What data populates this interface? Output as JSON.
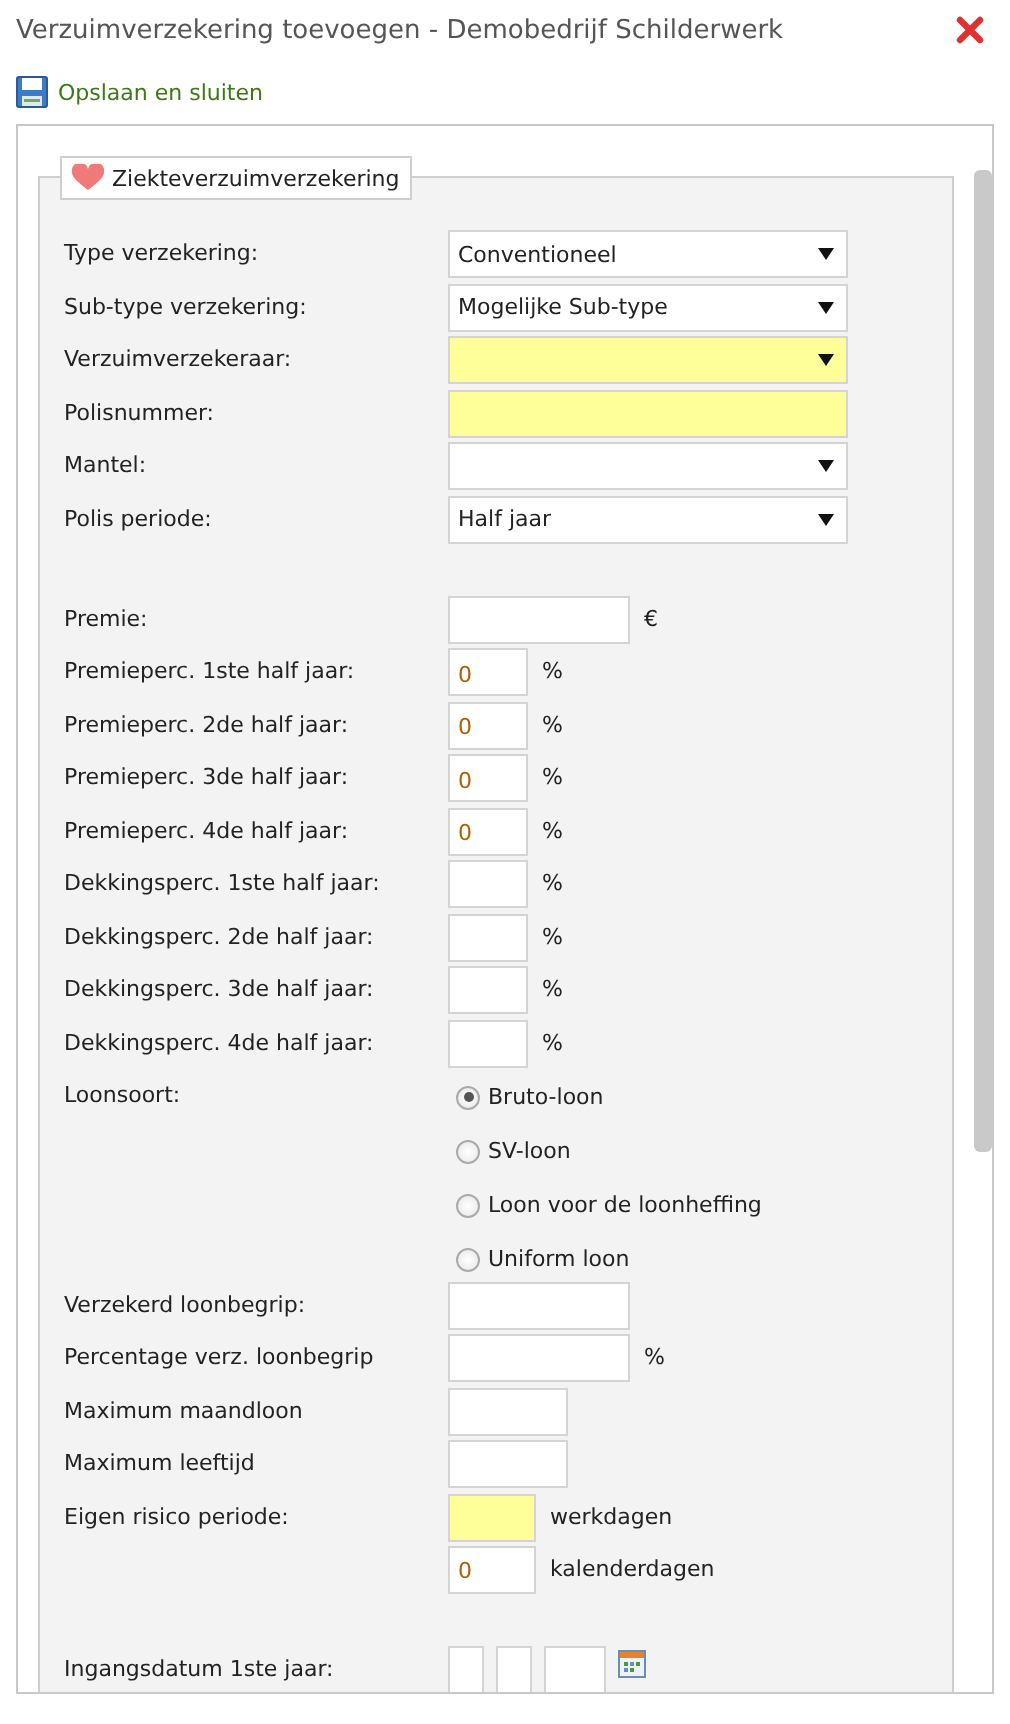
{
  "window": {
    "title": "Verzuimverzekering toevoegen - Demobedrijf Schilderwerk"
  },
  "toolbar": {
    "save_label": "Opslaan en sluiten"
  },
  "fieldset": {
    "legend": "Ziekteverzuimverzekering",
    "groups": [
      [
        {
          "kind": "select",
          "label": "Type verzekering:",
          "value": "Conventioneel",
          "required": false
        },
        {
          "kind": "select",
          "label": "Sub-type verzekering:",
          "value": "Mogelijke Sub-type",
          "required": false
        },
        {
          "kind": "select",
          "label": "Verzuimverzekeraar:",
          "required": true
        },
        {
          "kind": "text",
          "label": "Polisnummer:",
          "required": true
        },
        {
          "kind": "select",
          "label": "Mantel:",
          "required": false
        },
        {
          "kind": "select",
          "label": "Polis periode:",
          "value": "Half jaar",
          "required": false
        }
      ],
      [
        {
          "kind": "amount",
          "label": "Premie:",
          "unit": "€",
          "required": false
        },
        {
          "kind": "percent",
          "label": "Premieperc. 1ste half jaar:",
          "value": "0",
          "unit": "%",
          "required": false
        },
        {
          "kind": "percent",
          "label": "Premieperc. 2de half jaar:",
          "value": "0",
          "unit": "%",
          "required": false
        },
        {
          "kind": "percent",
          "label": "Premieperc. 3de half jaar:",
          "value": "0",
          "unit": "%",
          "required": false
        },
        {
          "kind": "percent",
          "label": "Premieperc. 4de half jaar:",
          "value": "0",
          "unit": "%",
          "required": false
        },
        {
          "kind": "percent",
          "label": "Dekkingsperc. 1ste half jaar:",
          "unit": "%",
          "required": false
        },
        {
          "kind": "percent",
          "label": "Dekkingsperc. 2de half jaar:",
          "unit": "%",
          "required": false
        },
        {
          "kind": "percent",
          "label": "Dekkingsperc. 3de half jaar:",
          "unit": "%",
          "required": false
        },
        {
          "kind": "percent",
          "label": "Dekkingsperc. 4de half jaar:",
          "unit": "%",
          "required": false
        },
        {
          "kind": "radio",
          "label": "Loonsoort:",
          "options": [
            {
              "label": "Bruto-loon",
              "selected": true
            },
            {
              "label": "SV-loon",
              "selected": false
            },
            {
              "label": "Loon voor de loonheffing",
              "selected": false
            },
            {
              "label": "Uniform loon",
              "selected": false
            }
          ]
        },
        {
          "kind": "amount",
          "label": "Verzekerd loonbegrip:",
          "required": false
        },
        {
          "kind": "amount",
          "label": "Percentage verz. loonbegrip",
          "unit": "%",
          "required": false
        },
        {
          "kind": "number",
          "label": "Maximum maandloon",
          "required": false
        },
        {
          "kind": "number",
          "label": "Maximum leeftijd",
          "required": false
        },
        {
          "kind": "multi",
          "label": "Eigen risico periode:",
          "inputs": [
            {
              "unit": "werkdagen",
              "required": true
            },
            {
              "value": "0",
              "unit": "kalenderdagen",
              "required": false
            }
          ]
        }
      ],
      [
        {
          "kind": "date",
          "label": "Ingangsdatum 1ste jaar:"
        }
      ]
    ]
  }
}
